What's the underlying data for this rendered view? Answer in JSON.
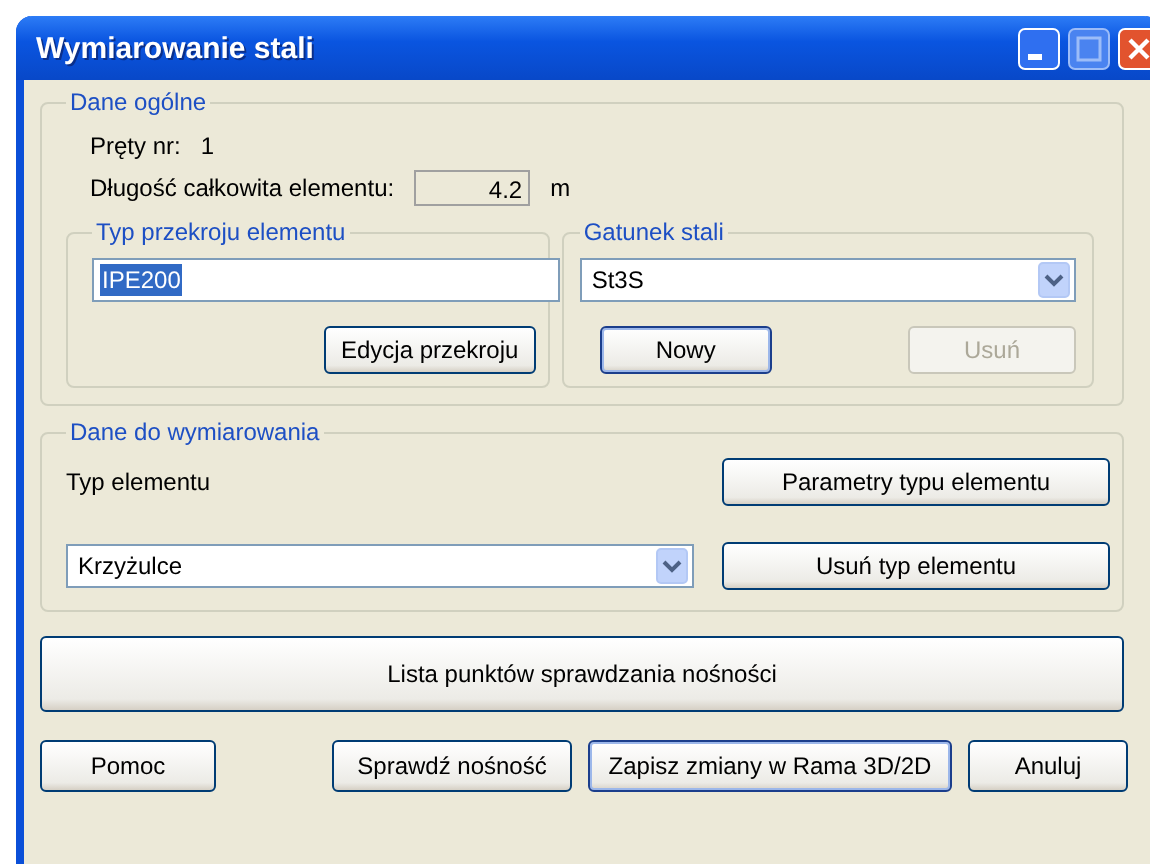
{
  "window": {
    "title": "Wymiarowanie stali"
  },
  "general": {
    "legend": "Dane ogólne",
    "bar_label": "Pręty nr:",
    "bar_number": "1",
    "length_label": "Długość całkowita elementu:",
    "length_value": "4.2",
    "length_unit": "m",
    "section": {
      "legend": "Typ przekroju elementu",
      "value": "IPE200",
      "value_selected": true,
      "edit_button": "Edycja przekroju"
    },
    "steel": {
      "legend": "Gatunek stali",
      "value": "St3S",
      "buttons": [
        {
          "label": "Nowy",
          "disabled": false,
          "default": true
        },
        {
          "label": "Usuń",
          "disabled": true,
          "default": false
        }
      ]
    }
  },
  "design": {
    "legend": "Dane do wymiarowania",
    "type_label": "Typ elementu",
    "type_value": "Krzyżulce",
    "buttons": [
      {
        "label": "Parametry typu elementu"
      },
      {
        "label": "Usuń typ elementu"
      }
    ]
  },
  "list_button": "Lista punktów sprawdzania nośności",
  "footer": [
    {
      "label": "Pomoc",
      "default": false
    },
    {
      "label": "Sprawdź nośność",
      "default": false
    },
    {
      "label": "Zapisz zmiany w Rama 3D/2D",
      "default": true
    },
    {
      "label": "Anuluj",
      "default": false
    }
  ]
}
